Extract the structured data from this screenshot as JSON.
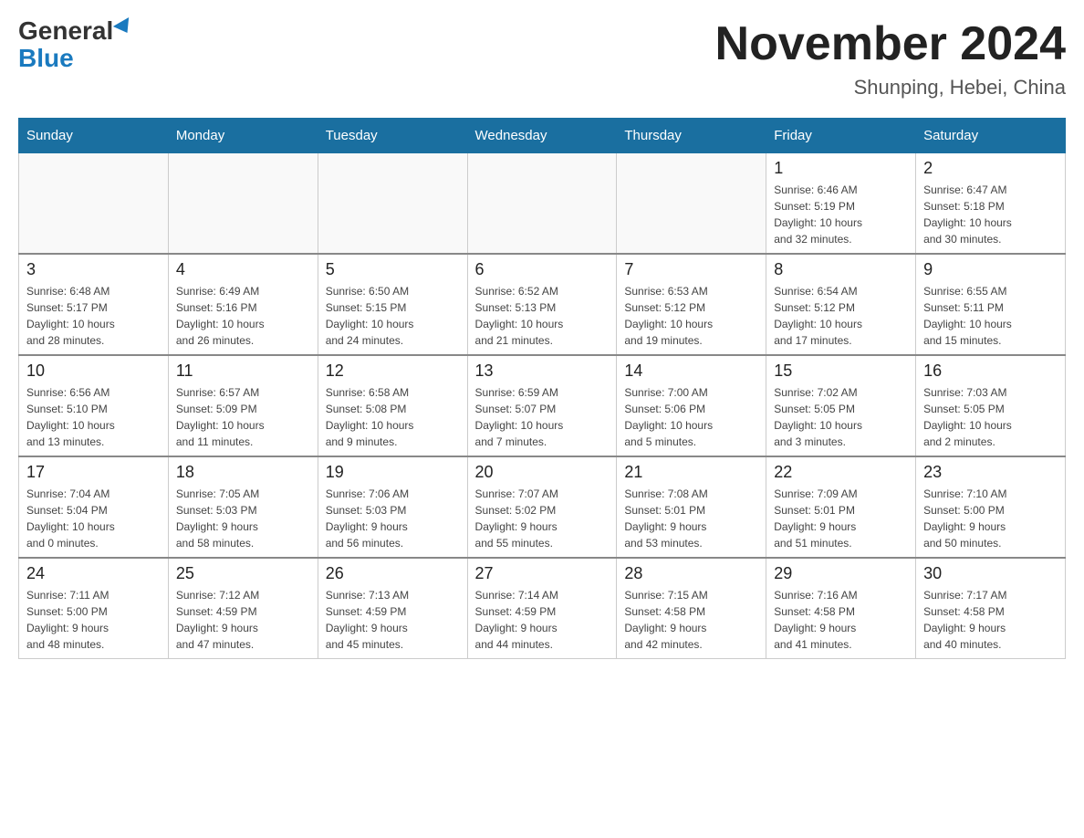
{
  "header": {
    "logo_general": "General",
    "logo_blue": "Blue",
    "title": "November 2024",
    "subtitle": "Shunping, Hebei, China"
  },
  "days_of_week": [
    "Sunday",
    "Monday",
    "Tuesday",
    "Wednesday",
    "Thursday",
    "Friday",
    "Saturday"
  ],
  "weeks": [
    [
      {
        "day": "",
        "info": ""
      },
      {
        "day": "",
        "info": ""
      },
      {
        "day": "",
        "info": ""
      },
      {
        "day": "",
        "info": ""
      },
      {
        "day": "",
        "info": ""
      },
      {
        "day": "1",
        "info": "Sunrise: 6:46 AM\nSunset: 5:19 PM\nDaylight: 10 hours\nand 32 minutes."
      },
      {
        "day": "2",
        "info": "Sunrise: 6:47 AM\nSunset: 5:18 PM\nDaylight: 10 hours\nand 30 minutes."
      }
    ],
    [
      {
        "day": "3",
        "info": "Sunrise: 6:48 AM\nSunset: 5:17 PM\nDaylight: 10 hours\nand 28 minutes."
      },
      {
        "day": "4",
        "info": "Sunrise: 6:49 AM\nSunset: 5:16 PM\nDaylight: 10 hours\nand 26 minutes."
      },
      {
        "day": "5",
        "info": "Sunrise: 6:50 AM\nSunset: 5:15 PM\nDaylight: 10 hours\nand 24 minutes."
      },
      {
        "day": "6",
        "info": "Sunrise: 6:52 AM\nSunset: 5:13 PM\nDaylight: 10 hours\nand 21 minutes."
      },
      {
        "day": "7",
        "info": "Sunrise: 6:53 AM\nSunset: 5:12 PM\nDaylight: 10 hours\nand 19 minutes."
      },
      {
        "day": "8",
        "info": "Sunrise: 6:54 AM\nSunset: 5:12 PM\nDaylight: 10 hours\nand 17 minutes."
      },
      {
        "day": "9",
        "info": "Sunrise: 6:55 AM\nSunset: 5:11 PM\nDaylight: 10 hours\nand 15 minutes."
      }
    ],
    [
      {
        "day": "10",
        "info": "Sunrise: 6:56 AM\nSunset: 5:10 PM\nDaylight: 10 hours\nand 13 minutes."
      },
      {
        "day": "11",
        "info": "Sunrise: 6:57 AM\nSunset: 5:09 PM\nDaylight: 10 hours\nand 11 minutes."
      },
      {
        "day": "12",
        "info": "Sunrise: 6:58 AM\nSunset: 5:08 PM\nDaylight: 10 hours\nand 9 minutes."
      },
      {
        "day": "13",
        "info": "Sunrise: 6:59 AM\nSunset: 5:07 PM\nDaylight: 10 hours\nand 7 minutes."
      },
      {
        "day": "14",
        "info": "Sunrise: 7:00 AM\nSunset: 5:06 PM\nDaylight: 10 hours\nand 5 minutes."
      },
      {
        "day": "15",
        "info": "Sunrise: 7:02 AM\nSunset: 5:05 PM\nDaylight: 10 hours\nand 3 minutes."
      },
      {
        "day": "16",
        "info": "Sunrise: 7:03 AM\nSunset: 5:05 PM\nDaylight: 10 hours\nand 2 minutes."
      }
    ],
    [
      {
        "day": "17",
        "info": "Sunrise: 7:04 AM\nSunset: 5:04 PM\nDaylight: 10 hours\nand 0 minutes."
      },
      {
        "day": "18",
        "info": "Sunrise: 7:05 AM\nSunset: 5:03 PM\nDaylight: 9 hours\nand 58 minutes."
      },
      {
        "day": "19",
        "info": "Sunrise: 7:06 AM\nSunset: 5:03 PM\nDaylight: 9 hours\nand 56 minutes."
      },
      {
        "day": "20",
        "info": "Sunrise: 7:07 AM\nSunset: 5:02 PM\nDaylight: 9 hours\nand 55 minutes."
      },
      {
        "day": "21",
        "info": "Sunrise: 7:08 AM\nSunset: 5:01 PM\nDaylight: 9 hours\nand 53 minutes."
      },
      {
        "day": "22",
        "info": "Sunrise: 7:09 AM\nSunset: 5:01 PM\nDaylight: 9 hours\nand 51 minutes."
      },
      {
        "day": "23",
        "info": "Sunrise: 7:10 AM\nSunset: 5:00 PM\nDaylight: 9 hours\nand 50 minutes."
      }
    ],
    [
      {
        "day": "24",
        "info": "Sunrise: 7:11 AM\nSunset: 5:00 PM\nDaylight: 9 hours\nand 48 minutes."
      },
      {
        "day": "25",
        "info": "Sunrise: 7:12 AM\nSunset: 4:59 PM\nDaylight: 9 hours\nand 47 minutes."
      },
      {
        "day": "26",
        "info": "Sunrise: 7:13 AM\nSunset: 4:59 PM\nDaylight: 9 hours\nand 45 minutes."
      },
      {
        "day": "27",
        "info": "Sunrise: 7:14 AM\nSunset: 4:59 PM\nDaylight: 9 hours\nand 44 minutes."
      },
      {
        "day": "28",
        "info": "Sunrise: 7:15 AM\nSunset: 4:58 PM\nDaylight: 9 hours\nand 42 minutes."
      },
      {
        "day": "29",
        "info": "Sunrise: 7:16 AM\nSunset: 4:58 PM\nDaylight: 9 hours\nand 41 minutes."
      },
      {
        "day": "30",
        "info": "Sunrise: 7:17 AM\nSunset: 4:58 PM\nDaylight: 9 hours\nand 40 minutes."
      }
    ]
  ]
}
